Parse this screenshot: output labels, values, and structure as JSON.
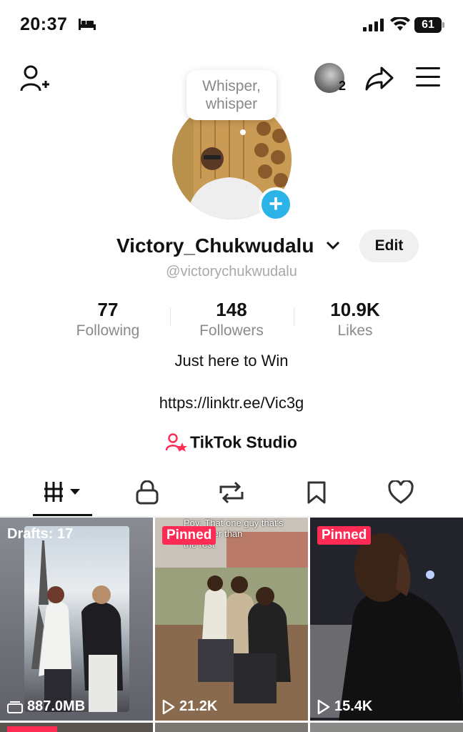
{
  "status_bar": {
    "time": "20:37",
    "battery": "61"
  },
  "header": {
    "switch_count": "2"
  },
  "avatar": {
    "tooltip_line1": "Whisper,",
    "tooltip_line2": "whisper"
  },
  "profile": {
    "name": "Victory_Chukwudalu",
    "handle": "@victorychukwudalu",
    "edit_label": "Edit",
    "bio": "Just here to Win",
    "link": "https://linktr.ee/Vic3g",
    "studio_label": "TikTok Studio"
  },
  "stats": [
    {
      "value": "77",
      "label": "Following"
    },
    {
      "value": "148",
      "label": "Followers"
    },
    {
      "value": "10.9K",
      "label": "Likes"
    }
  ],
  "tabs": [
    "videos-grid",
    "private",
    "reposts",
    "favorites",
    "liked"
  ],
  "grid": [
    {
      "overlay": "Drafts: 17",
      "footer": "887.0MB",
      "footer_icon": "storage-icon"
    },
    {
      "overlay": "Pinned",
      "caption": "Pov: That one guy that's\nbe cooler than\nthe rest",
      "footer": "21.2K",
      "footer_icon": "play-icon"
    },
    {
      "overlay": "Pinned",
      "footer": "15.4K",
      "footer_icon": "play-icon"
    }
  ],
  "colors": {
    "accent": "#fe2c55",
    "plus": "#2cb3e7"
  }
}
